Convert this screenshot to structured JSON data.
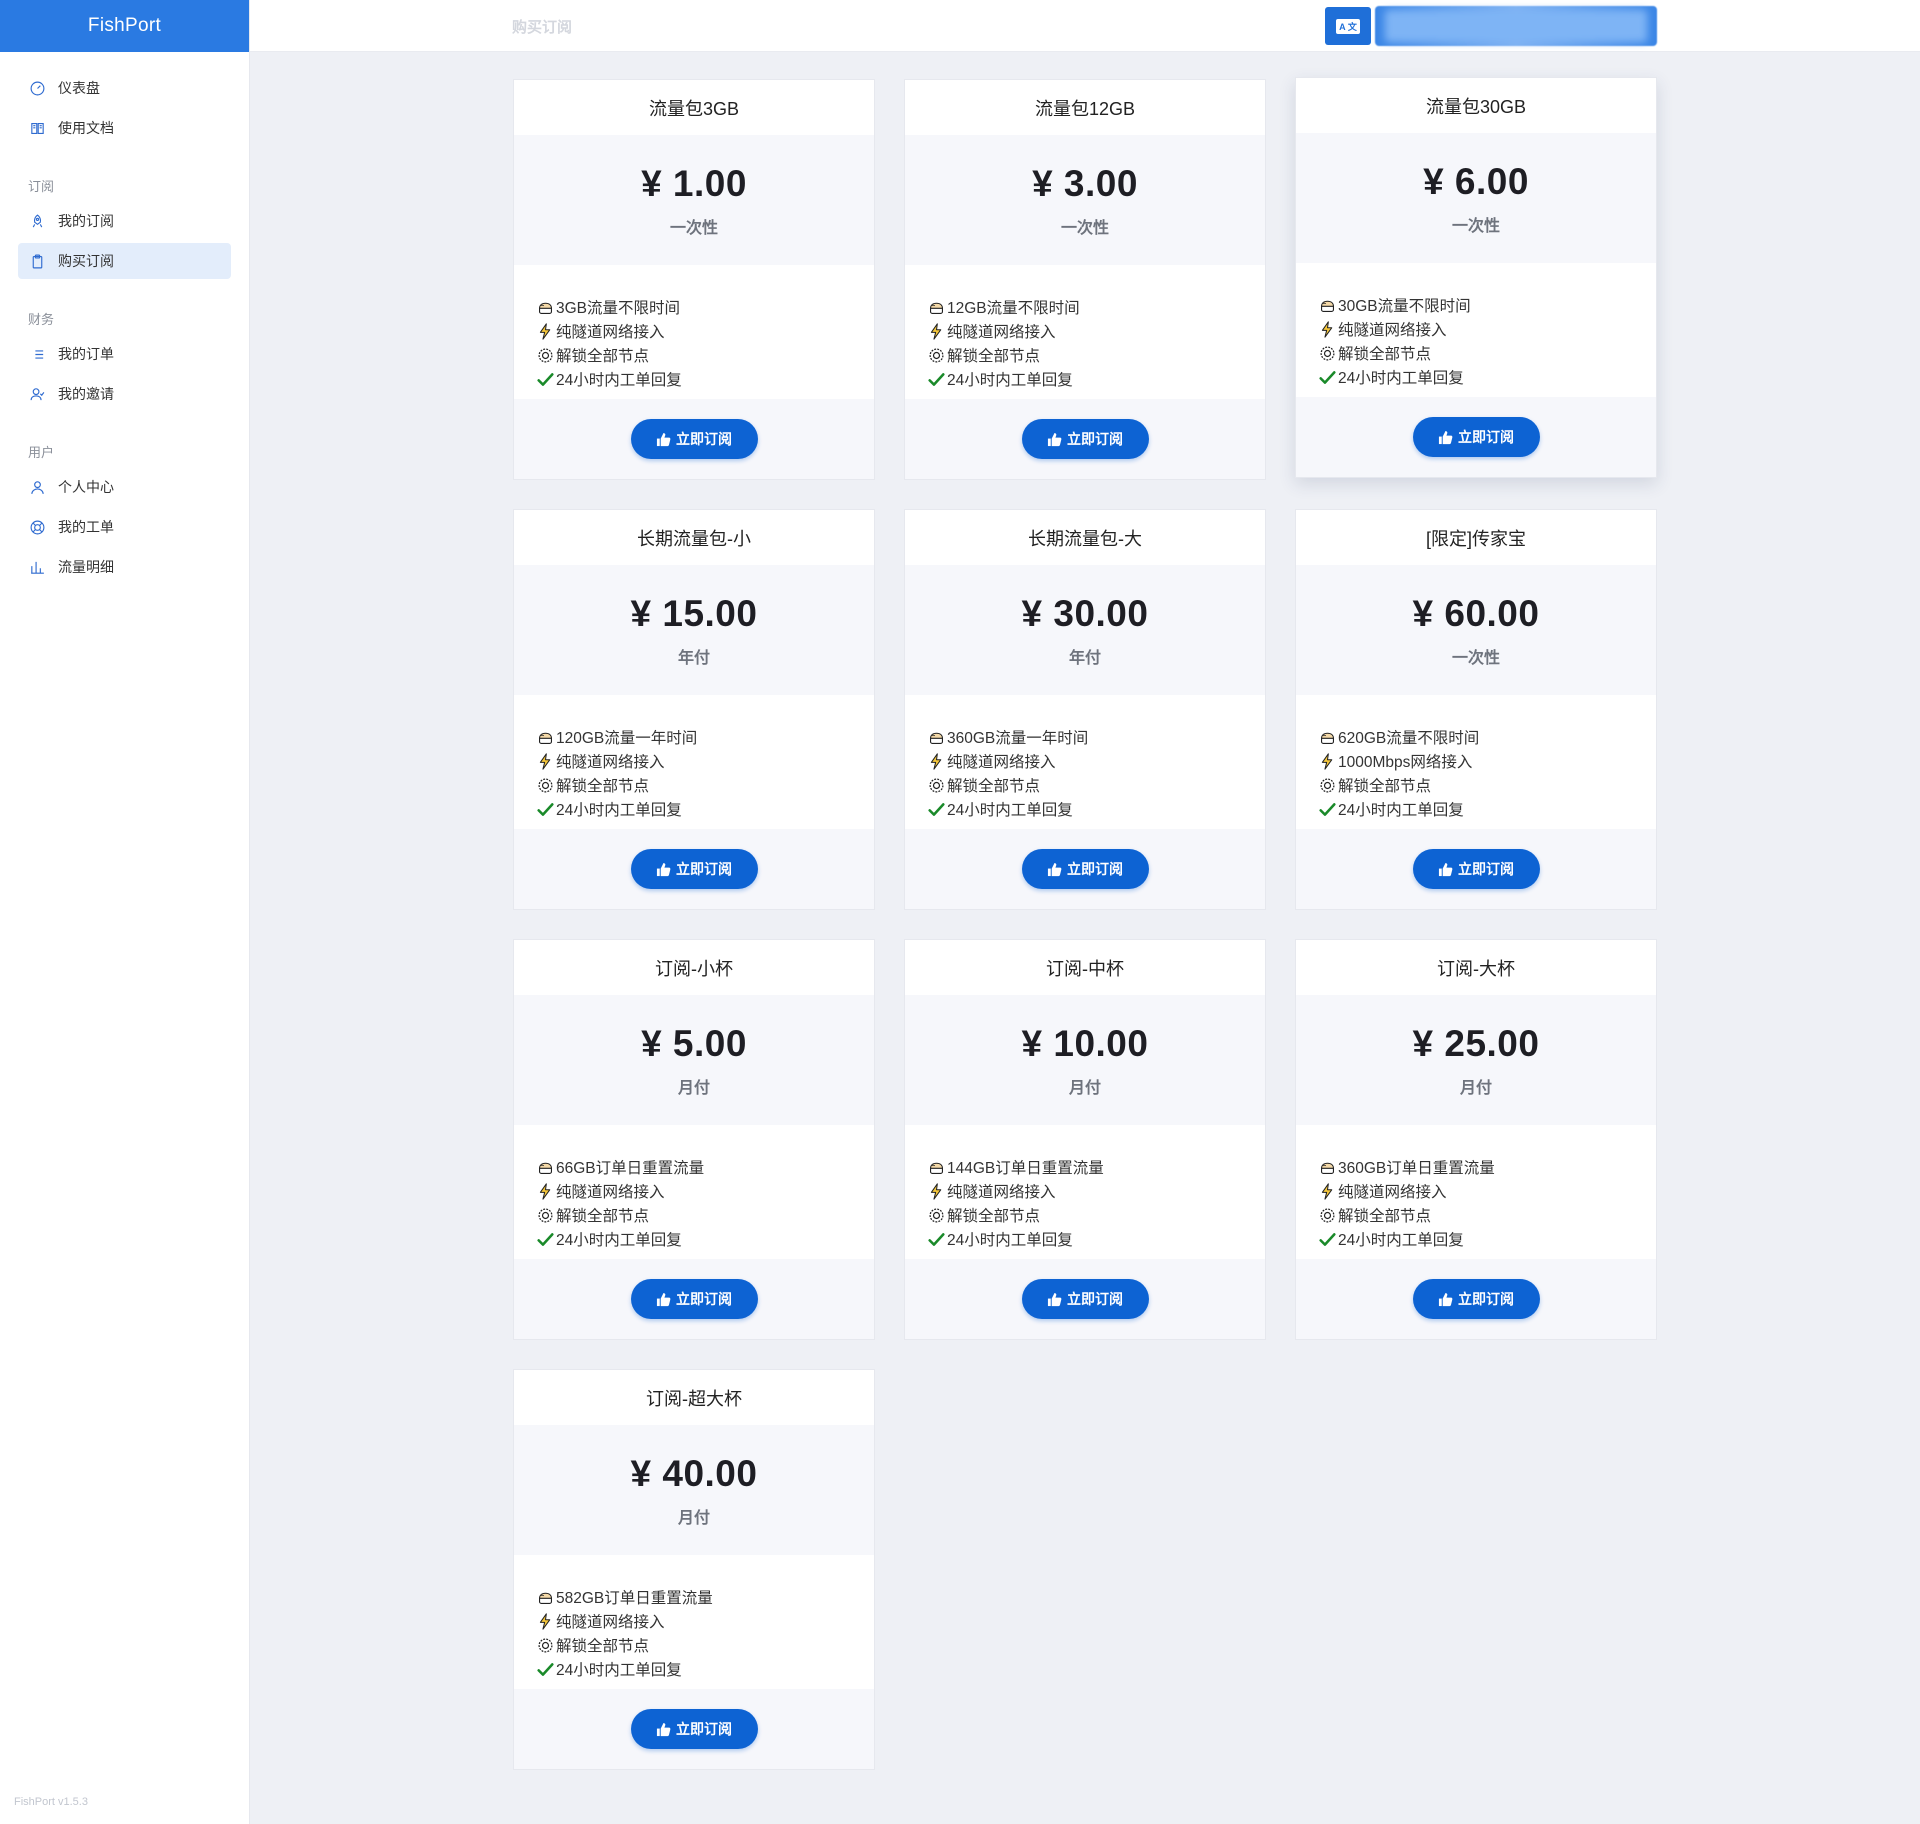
{
  "brand": "FishPort",
  "version": "FishPort v1.5.3",
  "header": {
    "title": "购买订阅",
    "lang_label": "A 文"
  },
  "nav": {
    "top": [
      {
        "label": "仪表盘",
        "icon": "gauge-icon"
      },
      {
        "label": "使用文档",
        "icon": "book-icon"
      }
    ],
    "sections": [
      {
        "title": "订阅",
        "items": [
          {
            "label": "我的订阅",
            "icon": "rocket-icon"
          },
          {
            "label": "购买订阅",
            "icon": "clipboard-icon",
            "active": true
          }
        ]
      },
      {
        "title": "财务",
        "items": [
          {
            "label": "我的订单",
            "icon": "list-icon"
          },
          {
            "label": "我的邀请",
            "icon": "users-icon"
          }
        ]
      },
      {
        "title": "用户",
        "items": [
          {
            "label": "个人中心",
            "icon": "user-icon"
          },
          {
            "label": "我的工单",
            "icon": "lifebuoy-icon"
          },
          {
            "label": "流量明细",
            "icon": "bar-chart-icon"
          }
        ]
      }
    ]
  },
  "button_label": "立即订阅",
  "plans": [
    {
      "name": "流量包3GB",
      "price": "¥ 1.00",
      "period": "一次性",
      "features": [
        "3GB流量不限时间",
        "纯隧道网络接入",
        "解锁全部节点",
        "24小时内工单回复"
      ]
    },
    {
      "name": "流量包12GB",
      "price": "¥ 3.00",
      "period": "一次性",
      "features": [
        "12GB流量不限时间",
        "纯隧道网络接入",
        "解锁全部节点",
        "24小时内工单回复"
      ]
    },
    {
      "name": "流量包30GB",
      "price": "¥ 6.00",
      "period": "一次性",
      "features": [
        "30GB流量不限时间",
        "纯隧道网络接入",
        "解锁全部节点",
        "24小时内工单回复"
      ]
    },
    {
      "name": "长期流量包-小",
      "price": "¥ 15.00",
      "period": "年付",
      "features": [
        "120GB流量一年时间",
        "纯隧道网络接入",
        "解锁全部节点",
        "24小时内工单回复"
      ]
    },
    {
      "name": "长期流量包-大",
      "price": "¥ 30.00",
      "period": "年付",
      "features": [
        "360GB流量一年时间",
        "纯隧道网络接入",
        "解锁全部节点",
        "24小时内工单回复"
      ]
    },
    {
      "name": "[限定]传家宝",
      "price": "¥ 60.00",
      "period": "一次性",
      "features": [
        "620GB流量不限时间",
        "1000Mbps网络接入",
        "解锁全部节点",
        "24小时内工单回复"
      ]
    },
    {
      "name": "订阅-小杯",
      "price": "¥ 5.00",
      "period": "月付",
      "features": [
        "66GB订单日重置流量",
        "纯隧道网络接入",
        "解锁全部节点",
        "24小时内工单回复"
      ]
    },
    {
      "name": "订阅-中杯",
      "price": "¥ 10.00",
      "period": "月付",
      "features": [
        "144GB订单日重置流量",
        "纯隧道网络接入",
        "解锁全部节点",
        "24小时内工单回复"
      ]
    },
    {
      "name": "订阅-大杯",
      "price": "¥ 25.00",
      "period": "月付",
      "features": [
        "360GB订单日重置流量",
        "纯隧道网络接入",
        "解锁全部节点",
        "24小时内工单回复"
      ]
    },
    {
      "name": "订阅-超大杯",
      "price": "¥ 40.00",
      "period": "月付",
      "features": [
        "582GB订单日重置流量",
        "纯隧道网络接入",
        "解锁全部节点",
        "24小时内工单回复"
      ]
    }
  ],
  "feature_icons": [
    "cake-icon",
    "lightning-icon",
    "gear-icon",
    "check-icon"
  ],
  "colors": {
    "brand": "#2a7ae2",
    "button": "#0d63d3",
    "active_nav": "#e3edfb"
  }
}
